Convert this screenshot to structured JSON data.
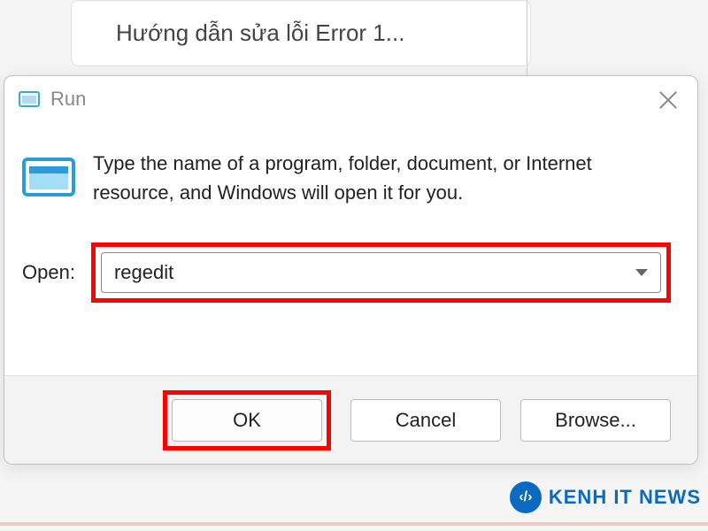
{
  "background": {
    "tab_text": "Hướng dẫn sửa lỗi Error 1..."
  },
  "dialog": {
    "title": "Run",
    "description": "Type the name of a program, folder, document, or Internet resource, and Windows will open it for you.",
    "open_label": "Open:",
    "input_value": "regedit",
    "buttons": {
      "ok": "OK",
      "cancel": "Cancel",
      "browse": "Browse..."
    }
  },
  "watermark": {
    "symbol": "‹/›",
    "text": "KENH IT NEWS"
  }
}
